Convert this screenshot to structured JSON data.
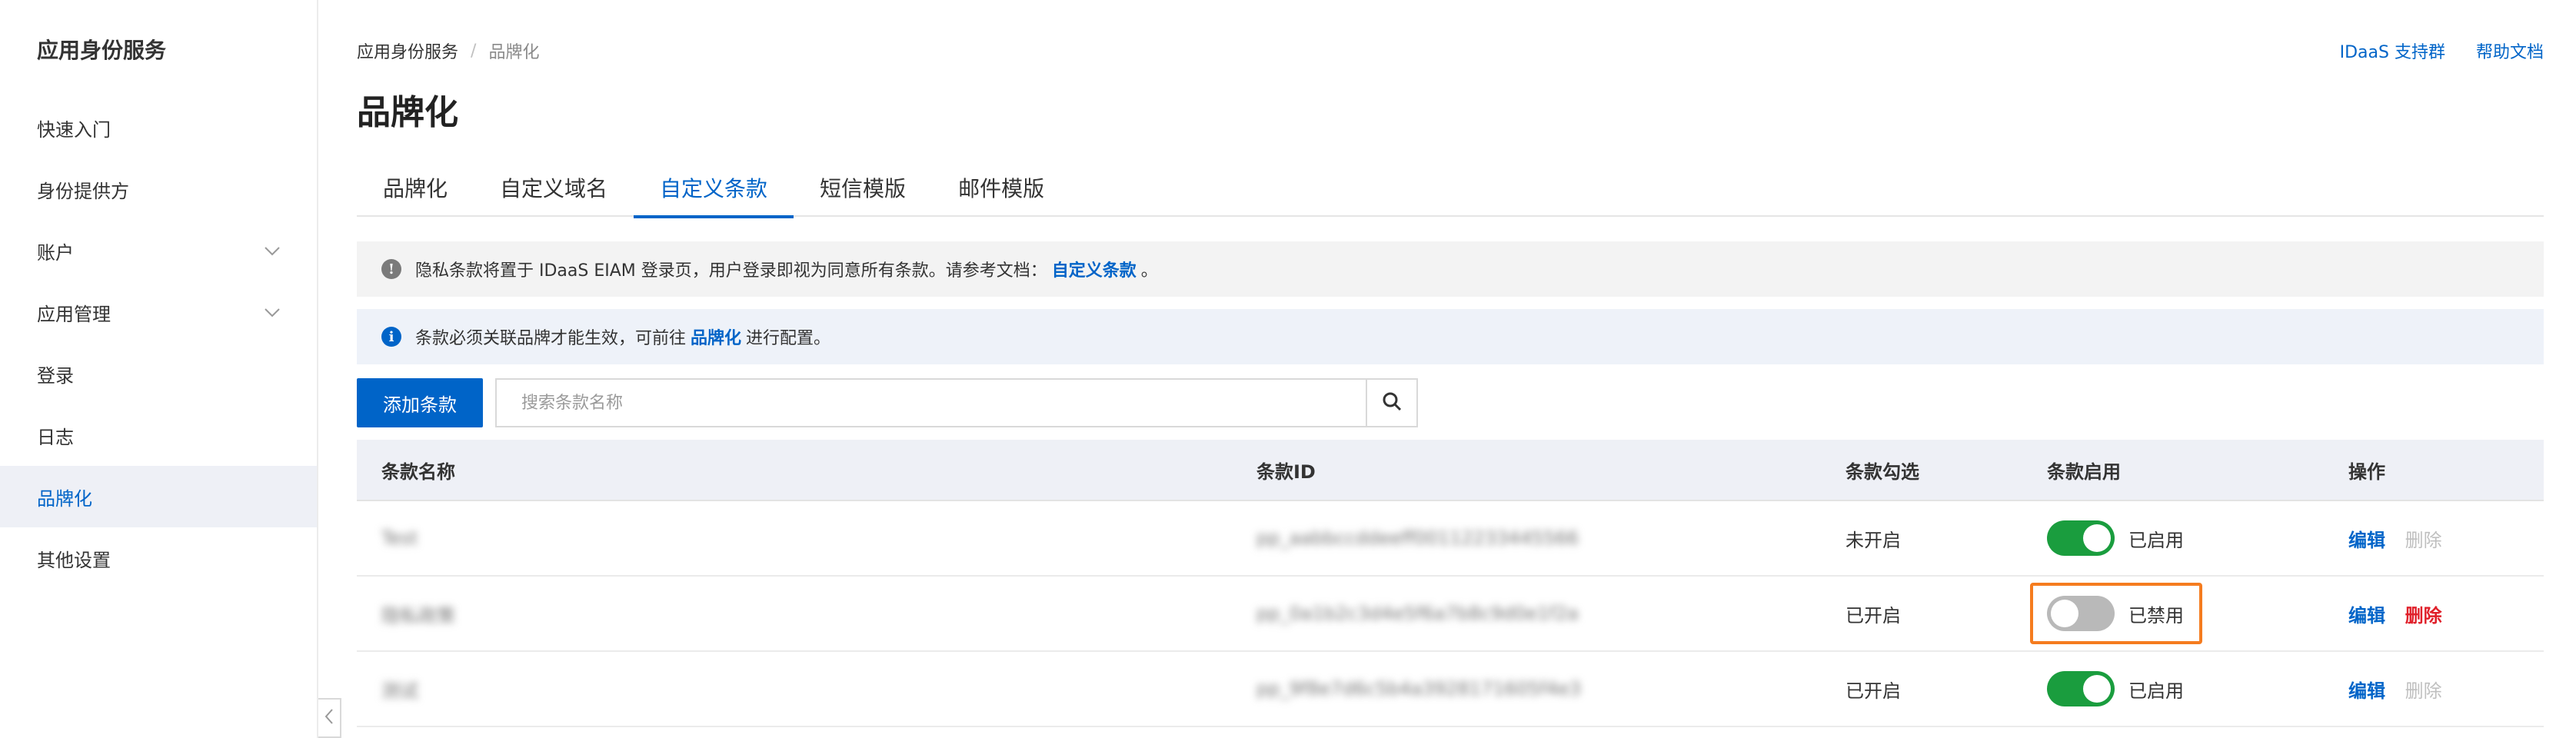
{
  "sidebar": {
    "title": "应用身份服务",
    "items": [
      {
        "label": "快速入门"
      },
      {
        "label": "身份提供方"
      },
      {
        "label": "账户"
      },
      {
        "label": "应用管理"
      },
      {
        "label": "登录"
      },
      {
        "label": "日志"
      },
      {
        "label": "品牌化"
      },
      {
        "label": "其他设置"
      }
    ]
  },
  "breadcrumb": {
    "root": "应用身份服务",
    "separator": "/",
    "current": "品牌化"
  },
  "top_links": {
    "support": "IDaaS 支持群",
    "help": "帮助文档"
  },
  "page_title": "品牌化",
  "tabs": [
    {
      "label": "品牌化"
    },
    {
      "label": "自定义域名"
    },
    {
      "label": "自定义条款"
    },
    {
      "label": "短信模版"
    },
    {
      "label": "邮件模版"
    }
  ],
  "alerts": {
    "warning": {
      "text": "隐私条款将置于 IDaaS EIAM 登录页，用户登录即视为同意所有条款。请参考文档：",
      "link": "自定义条款",
      "tail": "。"
    },
    "info": {
      "text": "条款必须关联品牌才能生效，可前往",
      "link": "品牌化",
      "tail": "进行配置。"
    }
  },
  "toolbar": {
    "add_label": "添加条款",
    "search_placeholder": "搜索条款名称"
  },
  "table": {
    "headers": [
      "条款名称",
      "条款ID",
      "条款勾选",
      "条款启用",
      "操作"
    ],
    "rows": [
      {
        "name": "Test",
        "id": "pp_aabbccddeeff00112233445566",
        "check": "未开启",
        "enable": "已启用",
        "edit": "编辑",
        "delete": "删除"
      },
      {
        "name": "隐私政策",
        "id": "pp_0a1b2c3d4e5f6a7b8c9d0e1f2a",
        "check": "已开启",
        "enable": "已禁用",
        "edit": "编辑",
        "delete": "删除"
      },
      {
        "name": "测试",
        "id": "pp_9f8e7d6c5b4a3928171605f4e3",
        "check": "已开启",
        "enable": "已启用",
        "edit": "编辑",
        "delete": "删除"
      }
    ]
  },
  "colors": {
    "accent": "#0064c8",
    "toggle_on": "#1a9d3e",
    "highlight": "#f57c1f",
    "danger": "#e0202a"
  }
}
